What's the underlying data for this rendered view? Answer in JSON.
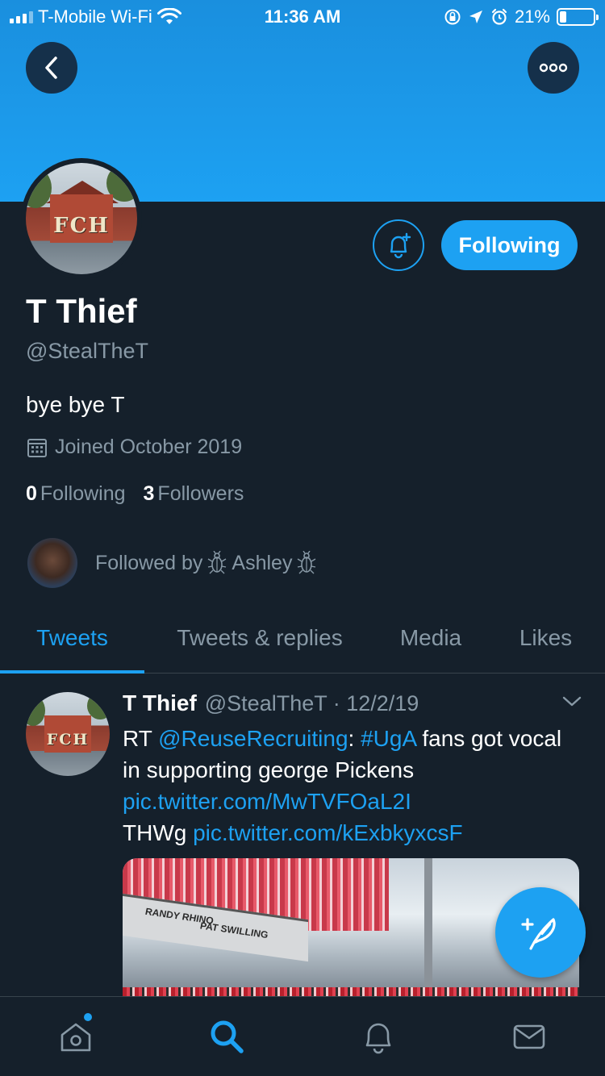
{
  "status_bar": {
    "carrier": "T-Mobile Wi-Fi",
    "time": "11:36 AM",
    "battery": "21%",
    "battery_level": 0.21
  },
  "profile": {
    "name": "T Thief",
    "handle": "@StealTheT",
    "bio": "bye bye T",
    "joined": "Joined October 2019",
    "following_count": "0",
    "following_label": "Following",
    "followers_count": "3",
    "followers_label": "Followers",
    "avatar_text": "FCH",
    "follow_button": "Following",
    "followed_by_label": "Followed by",
    "followed_by_name": "Ashley"
  },
  "tabs": [
    {
      "label": "Tweets",
      "active": true
    },
    {
      "label": "Tweets & replies",
      "active": false
    },
    {
      "label": "Media",
      "active": false
    },
    {
      "label": "Likes",
      "active": false
    }
  ],
  "tweet": {
    "name": "T Thief",
    "handle_date": "@StealTheT · 12/2/19",
    "rt_prefix": "RT ",
    "mention": "@ReuseRecruiting",
    "colon": ": ",
    "hashtag": "#UgA",
    "text_1": " fans got vocal in supporting george Pickens",
    "link_1": "pic.twitter.com/MwTVFOaL2I",
    "text_2": "THWg ",
    "link_2": "pic.twitter.com/kExbkyxcsF",
    "media_sign_1": "RANDY RHINO",
    "media_sign_2": "PAT SWILLING"
  },
  "colors": {
    "accent": "#1da1f2",
    "background": "#15202b",
    "secondary_text": "#8899a6"
  },
  "icons": [
    "back-icon",
    "more-icon",
    "notification-bell-icon",
    "calendar-icon",
    "chevron-down-icon",
    "compose-tweet-icon",
    "home-icon",
    "search-icon",
    "notifications-icon",
    "messages-icon"
  ]
}
